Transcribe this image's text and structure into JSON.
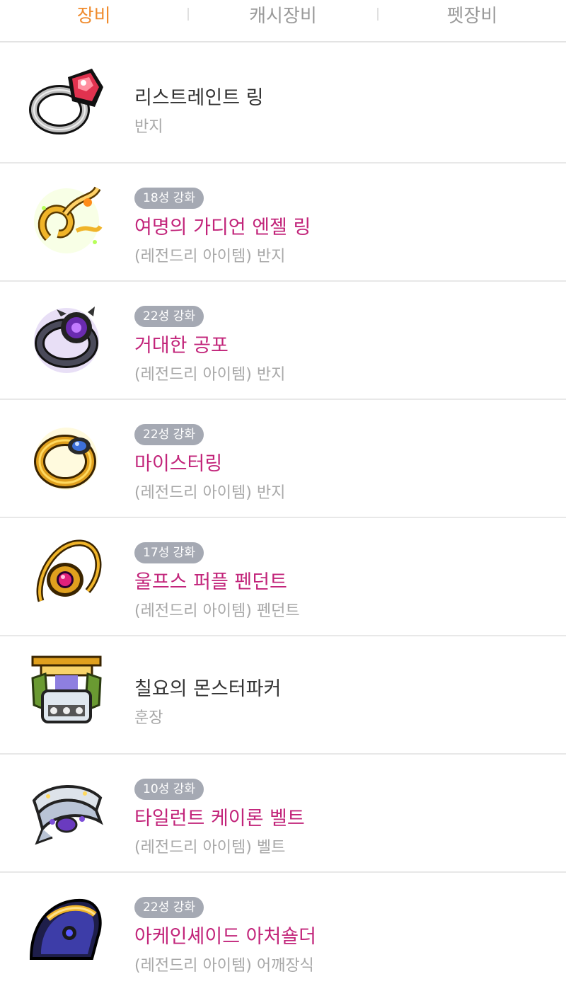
{
  "tabs": [
    {
      "label": "장비",
      "active": true
    },
    {
      "label": "캐시장비",
      "active": false
    },
    {
      "label": "펫장비",
      "active": false
    }
  ],
  "items": [
    {
      "name": "리스트레인트 링",
      "category": "반지",
      "badge": "",
      "icon": "ruby-ring-icon"
    },
    {
      "name": "여명의 가디언 엔젤 링",
      "category": "(레전드리 아이템) 반지",
      "badge": "18성 강화",
      "icon": "angel-ring-icon"
    },
    {
      "name": "거대한 공포",
      "category": "(레전드리 아이템) 반지",
      "badge": "22성 강화",
      "icon": "dark-ring-icon"
    },
    {
      "name": "마이스터링",
      "category": "(레전드리 아이템) 반지",
      "badge": "22성 강화",
      "icon": "meister-ring-icon"
    },
    {
      "name": "울프스 퍼플 펜던트",
      "category": "(레전드리 아이템) 펜던트",
      "badge": "17성 강화",
      "icon": "pendant-icon"
    },
    {
      "name": "칠요의 몬스터파커",
      "category": "훈장",
      "badge": "",
      "icon": "medal-icon"
    },
    {
      "name": "타일런트 케이론 벨트",
      "category": "(레전드리 아이템) 벨트",
      "badge": "10성 강화",
      "icon": "belt-icon"
    },
    {
      "name": "아케인셰이드 아처숄더",
      "category": "(레전드리 아이템) 어깨장식",
      "badge": "22성 강화",
      "icon": "shoulder-icon"
    }
  ],
  "colors": {
    "active_tab": "#f08b2d",
    "legendary_name": "#c2247a",
    "badge_bg": "#a5a9b3"
  }
}
